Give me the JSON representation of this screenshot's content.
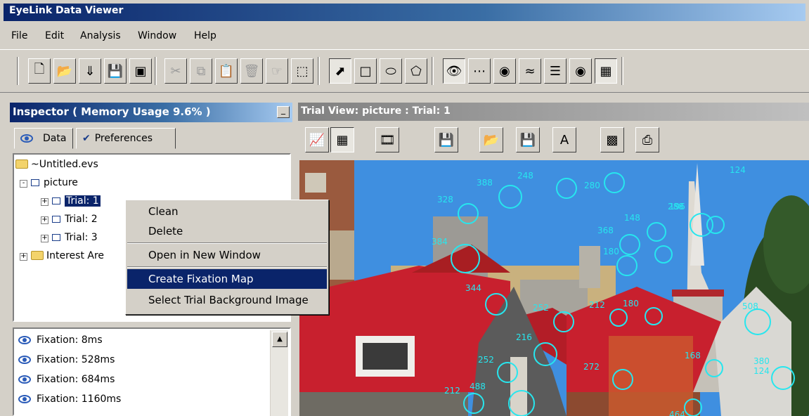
{
  "window": {
    "title": "EyeLink Data Viewer"
  },
  "menu": [
    "File",
    "Edit",
    "Analysis",
    "Window",
    "Help"
  ],
  "toolbar_icons": [
    "new-file-icon",
    "open-icon",
    "import-icon",
    "save-icon",
    "save-all-icon",
    "cut-icon",
    "copy-icon",
    "paste-icon",
    "delete-icon",
    "undo-icon",
    "select-area-icon",
    "pointer-icon",
    "rectangle-icon",
    "ellipse-icon",
    "freehand-icon",
    "fixation-icon",
    "saccade-icon",
    "blink-icon",
    "sample-icon",
    "message-icon",
    "interest-area-icon",
    "trial-view-icon"
  ],
  "inspector": {
    "title": "Inspector ( Memory Usage 9.6% )",
    "tabs": {
      "data": "Data",
      "preferences": "Preferences"
    },
    "tree": {
      "root": "~Untitled.evs",
      "session": "picture",
      "trials": [
        "Trial: 1",
        "Trial: 2",
        "Trial: 3"
      ],
      "interest": "Interest Are"
    },
    "fixations": [
      "Fixation: 8ms",
      "Fixation: 528ms",
      "Fixation: 684ms",
      "Fixation: 1160ms"
    ]
  },
  "context_menu": {
    "items": [
      "Clean",
      "Delete",
      "Open in New Window",
      "Create Fixation Map",
      "Select Trial Background Image"
    ],
    "selected": "Create Fixation Map"
  },
  "trial_view": {
    "title": "Trial View: picture : Trial: 1",
    "fixation_labels": [
      "388",
      "248",
      "280",
      "328",
      "148",
      "196",
      "384",
      "368",
      "180",
      "288",
      "124",
      "372",
      "344",
      "252",
      "212",
      "180",
      "508",
      "216",
      "168",
      "380",
      "124",
      "252",
      "272",
      "488",
      "212",
      "464",
      "312",
      "368"
    ]
  },
  "colors": {
    "fixation": "#27e6ee",
    "selection": "#0a246a"
  }
}
